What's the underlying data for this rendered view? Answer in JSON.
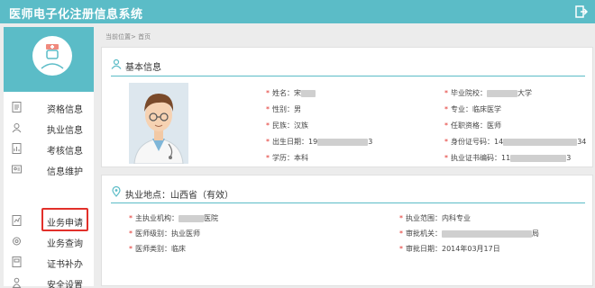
{
  "app": {
    "title": "医师电子化注册信息系统"
  },
  "sidebar": {
    "items": [
      {
        "label": "资格信息",
        "icon": "document-icon"
      },
      {
        "label": "执业信息",
        "icon": "user-icon"
      },
      {
        "label": "考核信息",
        "icon": "chart-icon"
      },
      {
        "label": "信息维护",
        "icon": "id-card-icon"
      },
      {
        "label": "业务申请",
        "icon": "form-icon"
      },
      {
        "label": "业务查询",
        "icon": "gear-icon"
      },
      {
        "label": "证书补办",
        "icon": "file-icon"
      },
      {
        "label": "安全设置",
        "icon": "person-icon"
      }
    ],
    "active_item": "业务申请"
  },
  "breadcrumb": "当前位置> 首页",
  "basic": {
    "title": "基本信息",
    "left": [
      {
        "label": "姓名：",
        "value_prefix": "宋"
      },
      {
        "label": "性别：",
        "value_prefix": "男"
      },
      {
        "label": "民族：",
        "value_prefix": "汉族"
      },
      {
        "label": "出生日期：",
        "value_prefix": "19",
        "value_suffix": "3"
      },
      {
        "label": "学历：",
        "value_prefix": "本科"
      }
    ],
    "right": [
      {
        "label": "毕业院校：",
        "value_prefix": "",
        "value_suffix": "大学"
      },
      {
        "label": "专业：",
        "value_prefix": "临床医学"
      },
      {
        "label": "任职资格：",
        "value_prefix": "医师"
      },
      {
        "label": "身份证号码：",
        "value_prefix": "14",
        "value_suffix": "34"
      },
      {
        "label": "执业证书编码：",
        "value_prefix": "11",
        "value_suffix": "3"
      }
    ]
  },
  "practice": {
    "title": "执业地点：山西省（有效）",
    "left": [
      {
        "label": "主执业机构：",
        "value_prefix": "",
        "value_suffix": "医院"
      },
      {
        "label": "医师级别：",
        "value_prefix": "执业医师"
      },
      {
        "label": "医师类别：",
        "value_prefix": "临床"
      }
    ],
    "right": [
      {
        "label": "执业范围：",
        "value_prefix": "内科专业"
      },
      {
        "label": "审批机关：",
        "value_prefix": "",
        "value_suffix": "局"
      },
      {
        "label": "审批日期：",
        "value_prefix": "2014年03月17日"
      }
    ]
  },
  "colors": {
    "accent": "#5bbcc7",
    "highlight": "#e2302a"
  }
}
